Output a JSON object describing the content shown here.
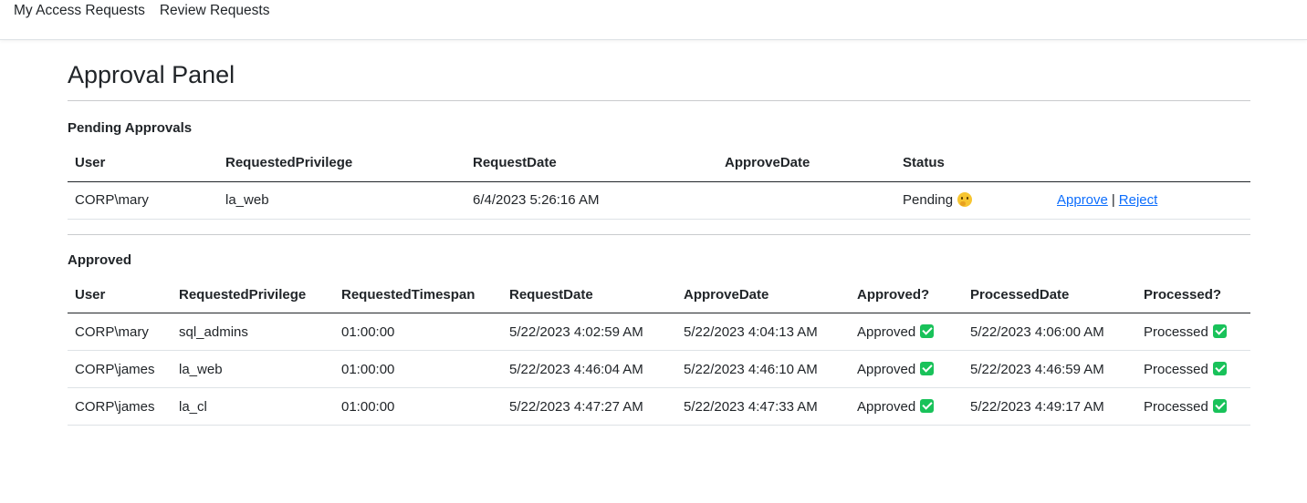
{
  "nav": {
    "items": [
      "My Access Requests",
      "Review Requests"
    ]
  },
  "page": {
    "title": "Approval Panel"
  },
  "pending": {
    "heading": "Pending Approvals",
    "columns": [
      "User",
      "RequestedPrivilege",
      "RequestDate",
      "ApproveDate",
      "Status",
      ""
    ],
    "rows": [
      {
        "user": "CORP\\mary",
        "privilege": "la_web",
        "request_date": "6/4/2023 5:26:16 AM",
        "approve_date": "",
        "status": "Pending",
        "status_icon": "thinking-face-icon",
        "approve_label": "Approve",
        "separator": "|",
        "reject_label": "Reject"
      }
    ]
  },
  "approved": {
    "heading": "Approved",
    "columns": [
      "User",
      "RequestedPrivilege",
      "RequestedTimespan",
      "RequestDate",
      "ApproveDate",
      "Approved?",
      "ProcessedDate",
      "Processed?"
    ],
    "rows": [
      {
        "user": "CORP\\mary",
        "privilege": "sql_admins",
        "timespan": "01:00:00",
        "request_date": "5/22/2023 4:02:59 AM",
        "approve_date": "5/22/2023 4:04:13 AM",
        "approved": "Approved",
        "processed_date": "5/22/2023 4:06:00 AM",
        "processed": "Processed"
      },
      {
        "user": "CORP\\james",
        "privilege": "la_web",
        "timespan": "01:00:00",
        "request_date": "5/22/2023 4:46:04 AM",
        "approve_date": "5/22/2023 4:46:10 AM",
        "approved": "Approved",
        "processed_date": "5/22/2023 4:46:59 AM",
        "processed": "Processed"
      },
      {
        "user": "CORP\\james",
        "privilege": "la_cl",
        "timespan": "01:00:00",
        "request_date": "5/22/2023 4:47:27 AM",
        "approve_date": "5/22/2023 4:47:33 AM",
        "approved": "Approved",
        "processed_date": "5/22/2023 4:49:17 AM",
        "processed": "Processed"
      }
    ],
    "check_icon": "check-mark-icon",
    "check_color": "#19c25a"
  }
}
